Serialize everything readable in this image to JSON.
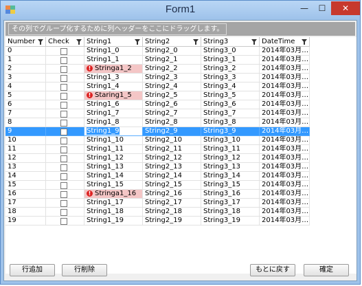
{
  "window": {
    "title": "Form1",
    "minimize_glyph": "—",
    "maximize_glyph": "☐",
    "close_glyph": "✕",
    "icon": "form-icon"
  },
  "group_panel": {
    "text": "その列でグループ化するために列ヘッダーをここにドラッグします。"
  },
  "columns": [
    "Number",
    "Check",
    "String1",
    "String2",
    "String3",
    "DateTime"
  ],
  "rows": [
    {
      "number": "0",
      "s1": "String1_0",
      "s2": "String2_0",
      "s3": "String3_0",
      "dt": "2014年03月…",
      "error": false,
      "selected": false
    },
    {
      "number": "1",
      "s1": "String1_1",
      "s2": "String2_1",
      "s3": "String3_1",
      "dt": "2014年03月…",
      "error": false,
      "selected": false
    },
    {
      "number": "2",
      "s1": "Stringa1_2",
      "s2": "String2_2",
      "s3": "String3_2",
      "dt": "2014年03月…",
      "error": true,
      "selected": false
    },
    {
      "number": "3",
      "s1": "String1_3",
      "s2": "String2_3",
      "s3": "String3_3",
      "dt": "2014年03月…",
      "error": false,
      "selected": false
    },
    {
      "number": "4",
      "s1": "String1_4",
      "s2": "String2_4",
      "s3": "String3_4",
      "dt": "2014年03月…",
      "error": false,
      "selected": false
    },
    {
      "number": "5",
      "s1": "Staring1_5",
      "s2": "String2_5",
      "s3": "String3_5",
      "dt": "2014年03月…",
      "error": true,
      "selected": false
    },
    {
      "number": "6",
      "s1": "String1_6",
      "s2": "String2_6",
      "s3": "String3_6",
      "dt": "2014年03月…",
      "error": false,
      "selected": false
    },
    {
      "number": "7",
      "s1": "String1_7",
      "s2": "String2_7",
      "s3": "String3_7",
      "dt": "2014年03月…",
      "error": false,
      "selected": false
    },
    {
      "number": "8",
      "s1": "String1_8",
      "s2": "String2_8",
      "s3": "String3_8",
      "dt": "2014年03月…",
      "error": false,
      "selected": false
    },
    {
      "number": "9",
      "s1": "String1_9",
      "s2": "String2_9",
      "s3": "String3_9",
      "dt": "2014年03月…",
      "error": false,
      "selected": true
    },
    {
      "number": "10",
      "s1": "String1_10",
      "s2": "String2_10",
      "s3": "String3_10",
      "dt": "2014年03月…",
      "error": false,
      "selected": false
    },
    {
      "number": "11",
      "s1": "String1_11",
      "s2": "String2_11",
      "s3": "String3_11",
      "dt": "2014年03月…",
      "error": false,
      "selected": false
    },
    {
      "number": "12",
      "s1": "String1_12",
      "s2": "String2_12",
      "s3": "String3_12",
      "dt": "2014年03月…",
      "error": false,
      "selected": false
    },
    {
      "number": "13",
      "s1": "String1_13",
      "s2": "String2_13",
      "s3": "String3_13",
      "dt": "2014年03月…",
      "error": false,
      "selected": false
    },
    {
      "number": "14",
      "s1": "String1_14",
      "s2": "String2_14",
      "s3": "String3_14",
      "dt": "2014年03月…",
      "error": false,
      "selected": false
    },
    {
      "number": "15",
      "s1": "String1_15",
      "s2": "String2_15",
      "s3": "String3_15",
      "dt": "2014年03月…",
      "error": false,
      "selected": false
    },
    {
      "number": "16",
      "s1": "Stringa1_16",
      "s2": "String2_16",
      "s3": "String3_16",
      "dt": "2014年03月…",
      "error": true,
      "selected": false
    },
    {
      "number": "17",
      "s1": "String1_17",
      "s2": "String2_17",
      "s3": "String3_17",
      "dt": "2014年03月…",
      "error": false,
      "selected": false
    },
    {
      "number": "18",
      "s1": "String1_18",
      "s2": "String2_18",
      "s3": "String3_18",
      "dt": "2014年03月…",
      "error": false,
      "selected": false
    },
    {
      "number": "19",
      "s1": "String1_19",
      "s2": "String2_19",
      "s3": "String3_19",
      "dt": "2014年03月…",
      "error": false,
      "selected": false
    }
  ],
  "buttons": {
    "add_row": "行追加",
    "delete_row": "行削除",
    "revert": "もとに戻す",
    "ok": "確定"
  },
  "colors": {
    "selection": "#3399ff",
    "error_bg": "#f4c6c6",
    "error_icon": "#d22222",
    "close_button": "#c7392d"
  }
}
